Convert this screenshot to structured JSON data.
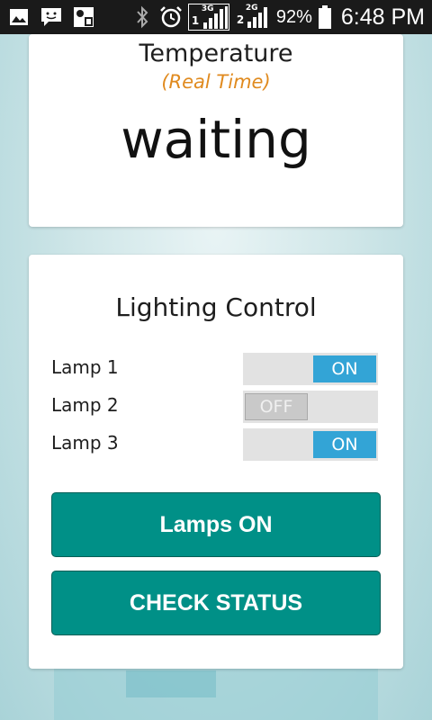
{
  "status_bar": {
    "icons": [
      "gallery-icon",
      "message-icon",
      "sim-icon",
      "bluetooth-icon",
      "alarm-icon"
    ],
    "network1": "3G",
    "network1_sim": "1",
    "network2": "2G",
    "network2_sim": "2",
    "battery_percent": "92%",
    "time": "6:48 PM"
  },
  "temperature": {
    "title": "Temperature",
    "subtitle": "(Real Time)",
    "value": "waiting"
  },
  "lighting": {
    "title": "Lighting Control",
    "lamps": [
      {
        "label": "Lamp 1",
        "state": "ON"
      },
      {
        "label": "Lamp 2",
        "state": "OFF"
      },
      {
        "label": "Lamp 3",
        "state": "ON"
      }
    ],
    "buttons": {
      "lamps_on": "Lamps ON",
      "check_status": "CHECK STATUS"
    }
  },
  "colors": {
    "accent": "#009087",
    "switch_on": "#33a4d6",
    "subtitle": "#e08a1e"
  }
}
